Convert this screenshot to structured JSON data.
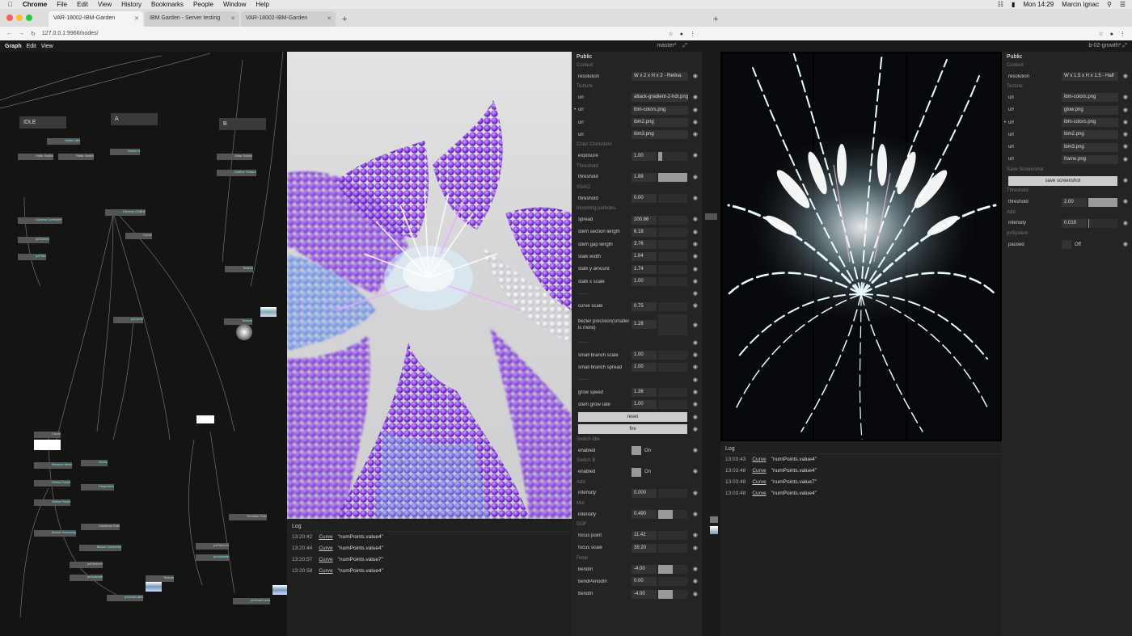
{
  "macbar": {
    "menu": [
      "Chrome",
      "File",
      "Edit",
      "View",
      "History",
      "Bookmarks",
      "People",
      "Window",
      "Help"
    ],
    "clock": "Mon 14:29",
    "user": "Marcin Ignac"
  },
  "browser1": {
    "tabs": [
      "VAR-18002-IBM-Garden",
      "IBM Garden - Server testing",
      "VAR-18002-IBM-Garden"
    ],
    "url": "127.0.0.1:9966/nodes/"
  },
  "app1": {
    "menu": [
      "Graph",
      "Edit",
      "View"
    ],
    "branch": "master*"
  },
  "app2": {
    "branch": "b-02-growth*"
  },
  "graph": {
    "groups": [
      "IDLE",
      "A",
      "B"
    ],
    "nodes": [
      "Switch Idle",
      "State Switch",
      "State Switch",
      "State Switch",
      "Camera Controller",
      "pxScreen",
      "pxFilter",
      "Generic Outline",
      "Curve",
      "pxCurve",
      "Texture",
      "Switch A",
      "Outline Texture",
      "Curve",
      "Resolve Mesh",
      "Select Petals",
      "Select Petals",
      "Bloom Geometry",
      "Bloom Geometry",
      "Distribute Path",
      "pxElement",
      "pxAnimate",
      "Texture",
      "pxDrawLabel",
      "Group",
      "Dispersion",
      "Simulate Path",
      "pxElement",
      "pxAnimate",
      "pxDrawCurve",
      "Texture"
    ]
  },
  "params1": {
    "title": "Public",
    "sections": {
      "context": "Context",
      "texture": "Texture",
      "color": "Color Correction",
      "threshold": "Threshold",
      "ssao": "SSAO",
      "incoming": "Incoming particles",
      "switchIdle": "Switch Idle",
      "switchB": "Switch B",
      "add": "Add",
      "mul": "Mul",
      "dof": "DOF",
      "petal": "Petal"
    },
    "resolution": {
      "label": "resolution",
      "value": "W x 2 x H x 2 - Retina"
    },
    "urls": [
      {
        "label": "url",
        "value": "attack-gradient-2-hdr.png"
      },
      {
        "label": "url",
        "value": "ibm-colors.png"
      },
      {
        "label": "url",
        "value": "ibm2.png"
      },
      {
        "label": "url",
        "value": "ibm3.png"
      }
    ],
    "exposure": {
      "label": "exposure",
      "value": "1.00",
      "fill": 0.14
    },
    "threshold": {
      "label": "threshold",
      "value": "1.88",
      "fill": 1.0
    },
    "ssaoThreshold": {
      "label": "threshold",
      "value": "0.00",
      "fill": 0
    },
    "particles": [
      {
        "label": "spread",
        "value": "200.86",
        "fill": 0
      },
      {
        "label": "stem section length",
        "value": "6.18",
        "fill": 0
      },
      {
        "label": "stem gap length",
        "value": "3.76",
        "fill": 0
      },
      {
        "label": "stalk width",
        "value": "1.64",
        "fill": 0
      },
      {
        "label": "stalk y amount",
        "value": "1.74",
        "fill": 0
      },
      {
        "label": "stalk x scale",
        "value": "1.00",
        "fill": 0
      }
    ],
    "separator": "------",
    "curve": [
      {
        "label": "curve scale",
        "value": "0.75",
        "fill": 0
      }
    ],
    "bezier": {
      "label": "bezier precision(smaller is more)",
      "value": "1.28"
    },
    "branch": [
      {
        "label": "small branch scale",
        "value": "1.00",
        "fill": 0
      },
      {
        "label": "small branch spread",
        "value": "1.00",
        "fill": 0
      }
    ],
    "grow": [
      {
        "label": "grow speed",
        "value": "1.36",
        "fill": 0
      },
      {
        "label": "stem grow rate",
        "value": "1.00",
        "fill": 0
      }
    ],
    "reset": "reset",
    "fire": "fire",
    "enabledIdle": {
      "label": "enabled",
      "state": "On"
    },
    "enabledB": {
      "label": "enabled",
      "state": "On"
    },
    "addIntensity": {
      "label": "intensity",
      "value": "0.000",
      "fill": 0
    },
    "mulIntensity": {
      "label": "intensity",
      "value": "0.490",
      "fill": 0.49
    },
    "focusPoint": {
      "label": "focus point",
      "value": "11.42"
    },
    "focusScale": {
      "label": "focus scale",
      "value": "39.20"
    },
    "bendIn": {
      "label": "bendIn",
      "value": "-4.00",
      "fill": 0.5
    },
    "bendPeriod": {
      "label": "bendPeriodIn",
      "value": "0.00"
    },
    "bendIn2": {
      "label": "bendIn",
      "value": "-4.00",
      "fill": 0.5
    }
  },
  "log1": {
    "title": "Log",
    "rows": [
      {
        "time": "13:20:42",
        "key": "Curve",
        "msg": "\"numPoints.value4\""
      },
      {
        "time": "13:20:44",
        "key": "Curve",
        "msg": "\"numPoints.value4\""
      },
      {
        "time": "13:20:57",
        "key": "Curve",
        "msg": "\"numPoints.value7\""
      },
      {
        "time": "13:20:58",
        "key": "Curve",
        "msg": "\"numPoints.value4\""
      }
    ]
  },
  "log2": {
    "title": "Log",
    "rows": [
      {
        "time": "13:03:43",
        "key": "Curve",
        "msg": "\"numPoints.value4\""
      },
      {
        "time": "13:03:48",
        "key": "Curve",
        "msg": "\"numPoints.value4\""
      },
      {
        "time": "13:03:48",
        "key": "Curve",
        "msg": "\"numPoints.value7\""
      },
      {
        "time": "13:03:48",
        "key": "Curve",
        "msg": "\"numPoints.value4\""
      }
    ]
  },
  "params2": {
    "title": "Public",
    "sections": {
      "context": "Context",
      "texture": "Texture",
      "save": "Save Screenshot",
      "threshold": "Threshold",
      "add": "Add",
      "px": "pxSystem"
    },
    "resolution": {
      "label": "resolution",
      "value": "W x 1.5 x H x 1.5 - Half"
    },
    "urls": [
      {
        "label": "url",
        "value": "ibm-colors.png"
      },
      {
        "label": "url",
        "value": "glow.png"
      },
      {
        "label": "url",
        "value": "ibm-colors.png"
      },
      {
        "label": "url",
        "value": "ibm2.png"
      },
      {
        "label": "url",
        "value": "ibm3.png"
      },
      {
        "label": "url",
        "value": "frame.png"
      }
    ],
    "saveBtn": "save screenshot",
    "threshold": {
      "label": "threshold",
      "value": "2.00",
      "fill": 1.0
    },
    "intensity": {
      "label": "intensity",
      "value": "0.019",
      "fill": 0.02
    },
    "paused": {
      "label": "paused",
      "state": "Off"
    }
  }
}
